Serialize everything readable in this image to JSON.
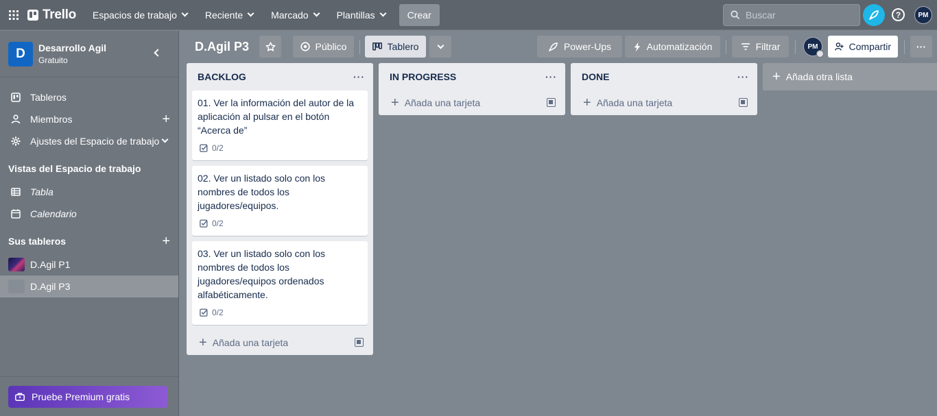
{
  "topbar": {
    "logo": "Trello",
    "nav": [
      "Espacios de trabajo",
      "Reciente",
      "Marcado",
      "Plantillas"
    ],
    "create": "Crear",
    "search_placeholder": "Buscar",
    "help": "?",
    "user_initials": "PM"
  },
  "sidebar": {
    "workspace_initial": "D",
    "workspace_name": "Desarrollo Agil",
    "workspace_plan": "Gratuito",
    "items": [
      {
        "label": "Tableros",
        "icon": "board-icon"
      },
      {
        "label": "Miembros",
        "icon": "person-icon"
      },
      {
        "label": "Ajustes del Espacio de trabajo",
        "icon": "gear-icon"
      }
    ],
    "views_heading": "Vistas del Espacio de trabajo",
    "views": [
      {
        "label": "Tabla",
        "icon": "table-icon"
      },
      {
        "label": "Calendario",
        "icon": "calendar-icon"
      }
    ],
    "boards_heading": "Sus tableros",
    "boards": [
      {
        "label": "D.Agil P1"
      },
      {
        "label": "D.Agil P3"
      }
    ],
    "premium": "Pruebe Premium gratis"
  },
  "board": {
    "title": "D.Agil P3",
    "visibility": "Público",
    "view": "Tablero",
    "powerups": "Power-Ups",
    "automation": "Automatización",
    "filter": "Filtrar",
    "member_initials": "PM",
    "share": "Compartir",
    "more": "···"
  },
  "lists": [
    {
      "title": "BACKLOG",
      "menu": "···",
      "cards": [
        {
          "text": "01. Ver la información del autor de la aplicación al pulsar en el botón “Acerca de”",
          "checklist": "0/2"
        },
        {
          "text": "02. Ver un listado solo con los nombres de todos los jugadores/equipos.",
          "checklist": "0/2"
        },
        {
          "text": "03. Ver un listado solo con los nombres de todos los jugadores/equipos ordenados alfabéticamente.",
          "checklist": "0/2"
        }
      ],
      "add_card": "Añada una tarjeta"
    },
    {
      "title": "IN PROGRESS",
      "menu": "···",
      "cards": [],
      "add_card": "Añada una tarjeta"
    },
    {
      "title": "DONE",
      "menu": "···",
      "cards": [],
      "add_card": "Añada una tarjeta"
    }
  ],
  "add_list": "Añada otra lista"
}
